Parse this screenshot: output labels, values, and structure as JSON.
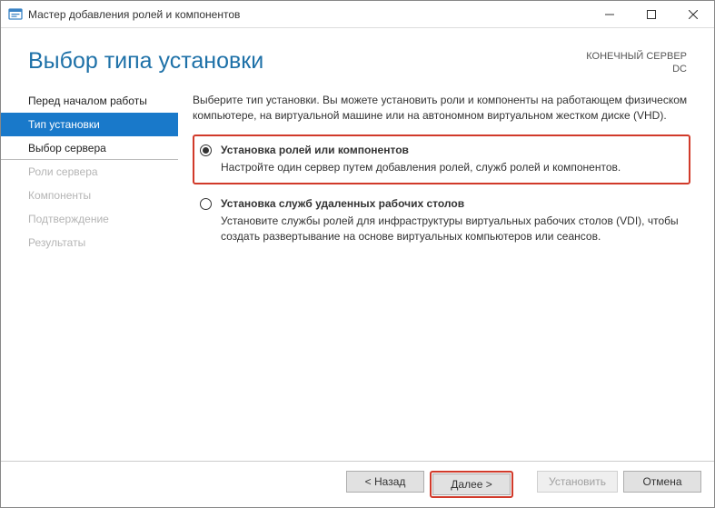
{
  "window": {
    "title": "Мастер добавления ролей и компонентов"
  },
  "header": {
    "page_title": "Выбор типа установки",
    "server_label": "КОНЕЧНЫЙ СЕРВЕР",
    "server_name": "DC"
  },
  "sidebar": {
    "steps": [
      {
        "label": "Перед началом работы",
        "state": "done"
      },
      {
        "label": "Тип установки",
        "state": "current"
      },
      {
        "label": "Выбор сервера",
        "state": "enabled"
      },
      {
        "label": "Роли сервера",
        "state": "disabled"
      },
      {
        "label": "Компоненты",
        "state": "disabled"
      },
      {
        "label": "Подтверждение",
        "state": "disabled"
      },
      {
        "label": "Результаты",
        "state": "disabled"
      }
    ]
  },
  "content": {
    "intro": "Выберите тип установки. Вы можете установить роли и компоненты на работающем физическом компьютере, на виртуальной машине или на автономном виртуальном жестком диске (VHD).",
    "options": [
      {
        "title": "Установка ролей или компонентов",
        "desc": "Настройте один сервер путем добавления ролей, служб ролей и компонентов.",
        "selected": true,
        "highlighted": true
      },
      {
        "title": "Установка служб удаленных рабочих столов",
        "desc": "Установите службы ролей для инфраструктуры виртуальных рабочих столов (VDI), чтобы создать развертывание на основе виртуальных компьютеров или сеансов.",
        "selected": false,
        "highlighted": false
      }
    ]
  },
  "footer": {
    "back": "< Назад",
    "next": "Далее >",
    "install": "Установить",
    "cancel": "Отмена",
    "next_highlighted": true,
    "install_enabled": false
  }
}
